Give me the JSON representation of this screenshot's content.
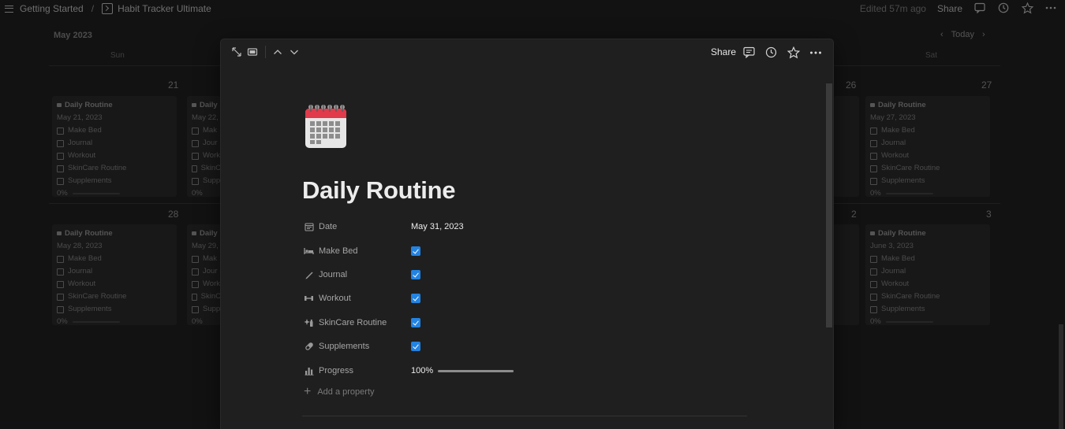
{
  "topbar": {
    "breadcrumb": [
      "Getting Started",
      "Habit Tracker Ultimate"
    ],
    "separator": "/",
    "edited": "Edited 57m ago",
    "share": "Share"
  },
  "calendar": {
    "month": "May 2023",
    "today": "Today",
    "dow_first": "Sun",
    "dow_last": "Sat",
    "week1": {
      "left_day": "21",
      "right_day": "27",
      "mid_day": "26",
      "cards": [
        {
          "title": "Daily Routine",
          "date": "May 21, 2023",
          "items": [
            "Make Bed",
            "Journal",
            "Workout",
            "SkinCare Routine",
            "Supplements"
          ],
          "progress": "0%"
        },
        {
          "title": "Daily",
          "date": "May 22,",
          "items": [
            "Mak",
            "Jour",
            "Work",
            "SkinC",
            "Supp"
          ],
          "progress": "0%"
        },
        {
          "title": "Daily Routine",
          "date": "May 27, 2023",
          "items": [
            "Make Bed",
            "Journal",
            "Workout",
            "SkinCare Routine",
            "Supplements"
          ],
          "progress": "0%"
        }
      ]
    },
    "week2": {
      "left_day": "28",
      "right_day": "3",
      "mid_day": "2",
      "cards": [
        {
          "title": "Daily Routine",
          "date": "May 28, 2023",
          "items": [
            "Make Bed",
            "Journal",
            "Workout",
            "SkinCare Routine",
            "Supplements"
          ],
          "progress": "0%"
        },
        {
          "title": "Daily",
          "date": "May 29,",
          "items": [
            "Mak",
            "Jour",
            "Work",
            "SkinC",
            "Supp"
          ],
          "progress": "0%"
        },
        {
          "title": "Daily Routine",
          "date": "June 3, 2023",
          "items": [
            "Make Bed",
            "Journal",
            "Workout",
            "SkinCare Routine",
            "Supplements"
          ],
          "progress": "0%"
        }
      ]
    }
  },
  "modal": {
    "share": "Share",
    "title": "Daily Routine",
    "properties": {
      "date": {
        "label": "Date",
        "value": "May 31, 2023"
      },
      "make_bed": {
        "label": "Make Bed",
        "checked": true
      },
      "journal": {
        "label": "Journal",
        "checked": true
      },
      "workout": {
        "label": "Workout",
        "checked": true
      },
      "skincare": {
        "label": "SkinCare Routine",
        "checked": true
      },
      "supplements": {
        "label": "Supplements",
        "checked": true
      },
      "progress": {
        "label": "Progress",
        "value": "100%",
        "fraction": 1.0
      }
    },
    "add_property": "Add a property"
  },
  "colors": {
    "checkbox": "#2383e2",
    "calendar_accent_red": "#e03a4b"
  },
  "icons": [
    "menu-icon",
    "page-icon",
    "comment-icon",
    "history-icon",
    "star-icon",
    "more-icon",
    "expand-icon",
    "layout-icon",
    "chevron-up-icon",
    "chevron-down-icon",
    "calendar-icon",
    "bed-icon",
    "pen-icon",
    "dumbbell-icon",
    "sparkle-icon",
    "pill-icon",
    "bar-chart-icon",
    "plus-icon"
  ]
}
